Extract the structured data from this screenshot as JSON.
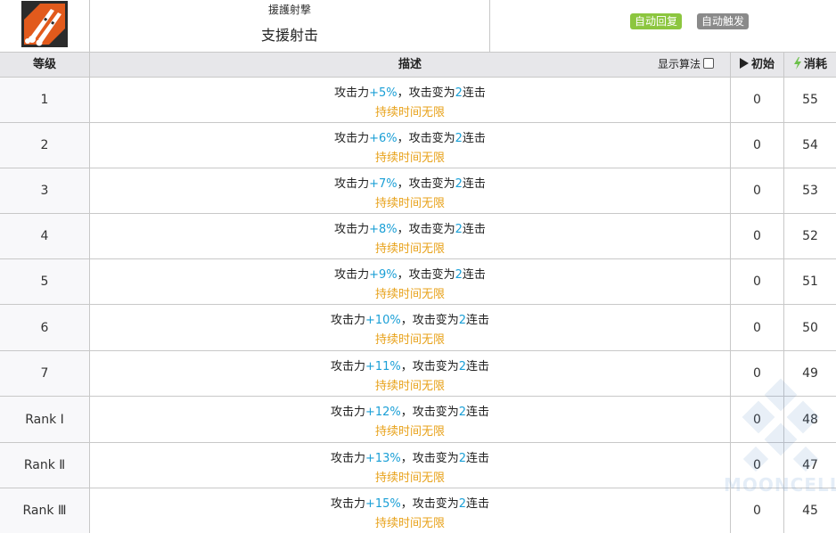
{
  "skill": {
    "name_jp": "援護射撃",
    "name_cn": "支援射击",
    "icon": "skill-icon-rocket",
    "tags": [
      "自动回复",
      "自动触发"
    ],
    "tag_colors": [
      "#8cc63f",
      "#8a8a8a"
    ]
  },
  "columns": {
    "level": "等级",
    "description": "描述",
    "show_formula": "显示算法",
    "initial": "初始",
    "cost": "消耗"
  },
  "rows": [
    {
      "level": "1",
      "atk": "+5%",
      "mid": "，攻击变为",
      "hits": "2",
      "suffix": "连击",
      "prefix": "攻击力",
      "duration": "持续时间无限",
      "initial": "0",
      "cost": "55"
    },
    {
      "level": "2",
      "atk": "+6%",
      "mid": "，攻击变为",
      "hits": "2",
      "suffix": "连击",
      "prefix": "攻击力",
      "duration": "持续时间无限",
      "initial": "0",
      "cost": "54"
    },
    {
      "level": "3",
      "atk": "+7%",
      "mid": "，攻击变为",
      "hits": "2",
      "suffix": "连击",
      "prefix": "攻击力",
      "duration": "持续时间无限",
      "initial": "0",
      "cost": "53"
    },
    {
      "level": "4",
      "atk": "+8%",
      "mid": "，攻击变为",
      "hits": "2",
      "suffix": "连击",
      "prefix": "攻击力",
      "duration": "持续时间无限",
      "initial": "0",
      "cost": "52"
    },
    {
      "level": "5",
      "atk": "+9%",
      "mid": "，攻击变为",
      "hits": "2",
      "suffix": "连击",
      "prefix": "攻击力",
      "duration": "持续时间无限",
      "initial": "0",
      "cost": "51"
    },
    {
      "level": "6",
      "atk": "+10%",
      "mid": "，攻击变为",
      "hits": "2",
      "suffix": "连击",
      "prefix": "攻击力",
      "duration": "持续时间无限",
      "initial": "0",
      "cost": "50"
    },
    {
      "level": "7",
      "atk": "+11%",
      "mid": "，攻击变为",
      "hits": "2",
      "suffix": "连击",
      "prefix": "攻击力",
      "duration": "持续时间无限",
      "initial": "0",
      "cost": "49"
    },
    {
      "level": "Rank Ⅰ",
      "atk": "+12%",
      "mid": "，攻击变为",
      "hits": "2",
      "suffix": "连击",
      "prefix": "攻击力",
      "duration": "持续时间无限",
      "initial": "0",
      "cost": "48"
    },
    {
      "level": "Rank Ⅱ",
      "atk": "+13%",
      "mid": "，攻击变为",
      "hits": "2",
      "suffix": "连击",
      "prefix": "攻击力",
      "duration": "持续时间无限",
      "initial": "0",
      "cost": "47"
    },
    {
      "level": "Rank Ⅲ",
      "atk": "+15%",
      "mid": "，攻击变为",
      "hits": "2",
      "suffix": "连击",
      "prefix": "攻击力",
      "duration": "持续时间无限",
      "initial": "0",
      "cost": "45"
    }
  ],
  "colors": {
    "value_blue": "#1a9fd6",
    "duration_orange": "#e8a21a",
    "header_bg": "#e7e7ea"
  },
  "watermark": "MOONCELL"
}
